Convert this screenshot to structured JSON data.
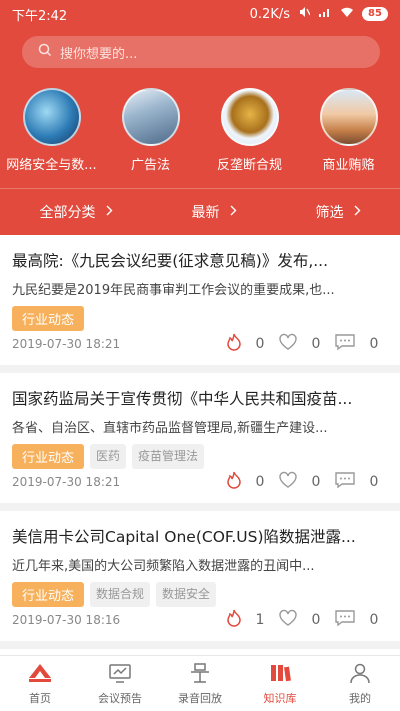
{
  "status_bar": {
    "time": "下午2:42",
    "network": "0.2K/s",
    "battery": "85"
  },
  "search": {
    "placeholder": "搜你想要的..."
  },
  "categories": [
    {
      "label": "网络安全与数..."
    },
    {
      "label": "广告法"
    },
    {
      "label": "反垄断合规"
    },
    {
      "label": "商业贿赂"
    }
  ],
  "filters": [
    {
      "label": "全部分类"
    },
    {
      "label": "最新"
    },
    {
      "label": "筛选"
    }
  ],
  "articles": [
    {
      "title": "最高院:《九民会议纪要(征求意见稿)》发布,...",
      "summary": "九民纪要是2019年民商事审判工作会议的重要成果,也...",
      "tags": [
        "行业动态"
      ],
      "date": "2019-07-30 18:21",
      "hot": "0",
      "likes": "0",
      "comments": "0"
    },
    {
      "title": "国家药监局关于宣传贯彻《中华人民共和国疫苗...",
      "summary": "各省、自治区、直辖市药品监督管理局,新疆生产建设...",
      "tags": [
        "行业动态",
        "医药",
        "疫苗管理法"
      ],
      "date": "2019-07-30 18:21",
      "hot": "0",
      "likes": "0",
      "comments": "0"
    },
    {
      "title": "美信用卡公司Capital One(COF.US)陷数据泄露...",
      "summary": "近几年来,美国的大公司频繁陷入数据泄露的丑闻中...",
      "tags": [
        "行业动态",
        "数据合规",
        "数据安全"
      ],
      "date": "2019-07-30 18:16",
      "hot": "1",
      "likes": "0",
      "comments": "0"
    }
  ],
  "tabbar": [
    {
      "label": "首页",
      "icon": "home-logo-icon"
    },
    {
      "label": "会议预告",
      "icon": "meeting-icon"
    },
    {
      "label": "录音回放",
      "icon": "playback-icon"
    },
    {
      "label": "知识库",
      "icon": "library-icon"
    },
    {
      "label": "我的",
      "icon": "profile-icon"
    }
  ],
  "colors": {
    "brand": "#e24a3d",
    "tag": "#f7b15d"
  }
}
